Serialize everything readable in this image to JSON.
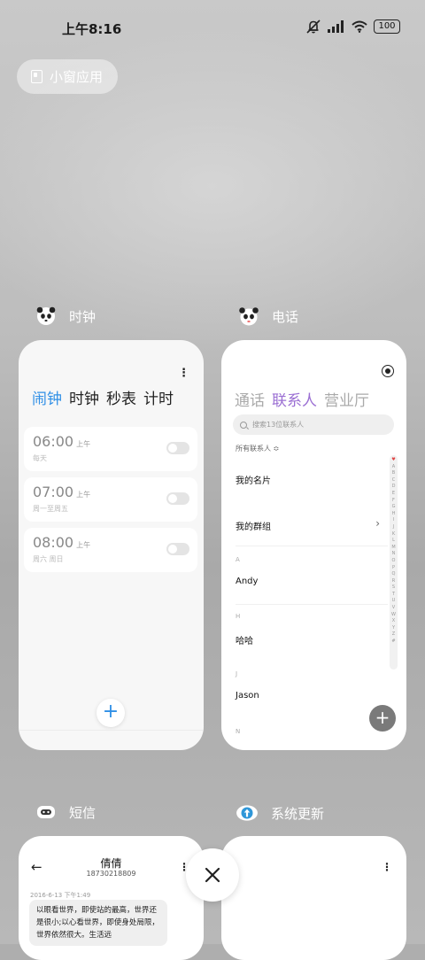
{
  "status_bar": {
    "time": "上午8:16",
    "battery": "100"
  },
  "pill": {
    "label": "小窗应用"
  },
  "apps": {
    "clock": {
      "label": "时钟",
      "tabs": [
        "闹钟",
        "时钟",
        "秒表",
        "计时"
      ],
      "alarms": [
        {
          "time": "06:00",
          "ampm": "上午",
          "repeat": "每天"
        },
        {
          "time": "07:00",
          "ampm": "上午",
          "repeat": "周一至周五"
        },
        {
          "time": "08:00",
          "ampm": "上午",
          "repeat": "周六 周日"
        }
      ],
      "add": "+"
    },
    "phone": {
      "label": "电话",
      "tabs": [
        "通话",
        "联系人",
        "营业厅"
      ],
      "search_placeholder": "搜索13位联系人",
      "all_contacts": "所有联系人 ≎",
      "my_card": "我的名片",
      "my_groups": "我的群组",
      "sections": [
        {
          "letter": "A",
          "name": "Andy"
        },
        {
          "letter": "H",
          "name": "哈哈"
        },
        {
          "letter": "J",
          "name": "Jason"
        },
        {
          "letter": "N",
          "name": ""
        }
      ],
      "index": [
        "♥",
        "A",
        "B",
        "C",
        "D",
        "E",
        "F",
        "G",
        "H",
        "I",
        "J",
        "K",
        "L",
        "M",
        "N",
        "O",
        "P",
        "Q",
        "R",
        "S",
        "T",
        "U",
        "V",
        "W",
        "X",
        "Y",
        "Z",
        "#"
      ],
      "add": "+"
    },
    "messages": {
      "label": "短信",
      "contact_name": "倩倩",
      "contact_number": "18730218809",
      "date": "2016-6-13 下午1:49",
      "bubble": "以眼看世界，即使站的最高，世界还是很小;以心看世界，即使身处局限，世界依然很大。生活远"
    },
    "system_update": {
      "label": "系统更新"
    }
  },
  "close": "×"
}
